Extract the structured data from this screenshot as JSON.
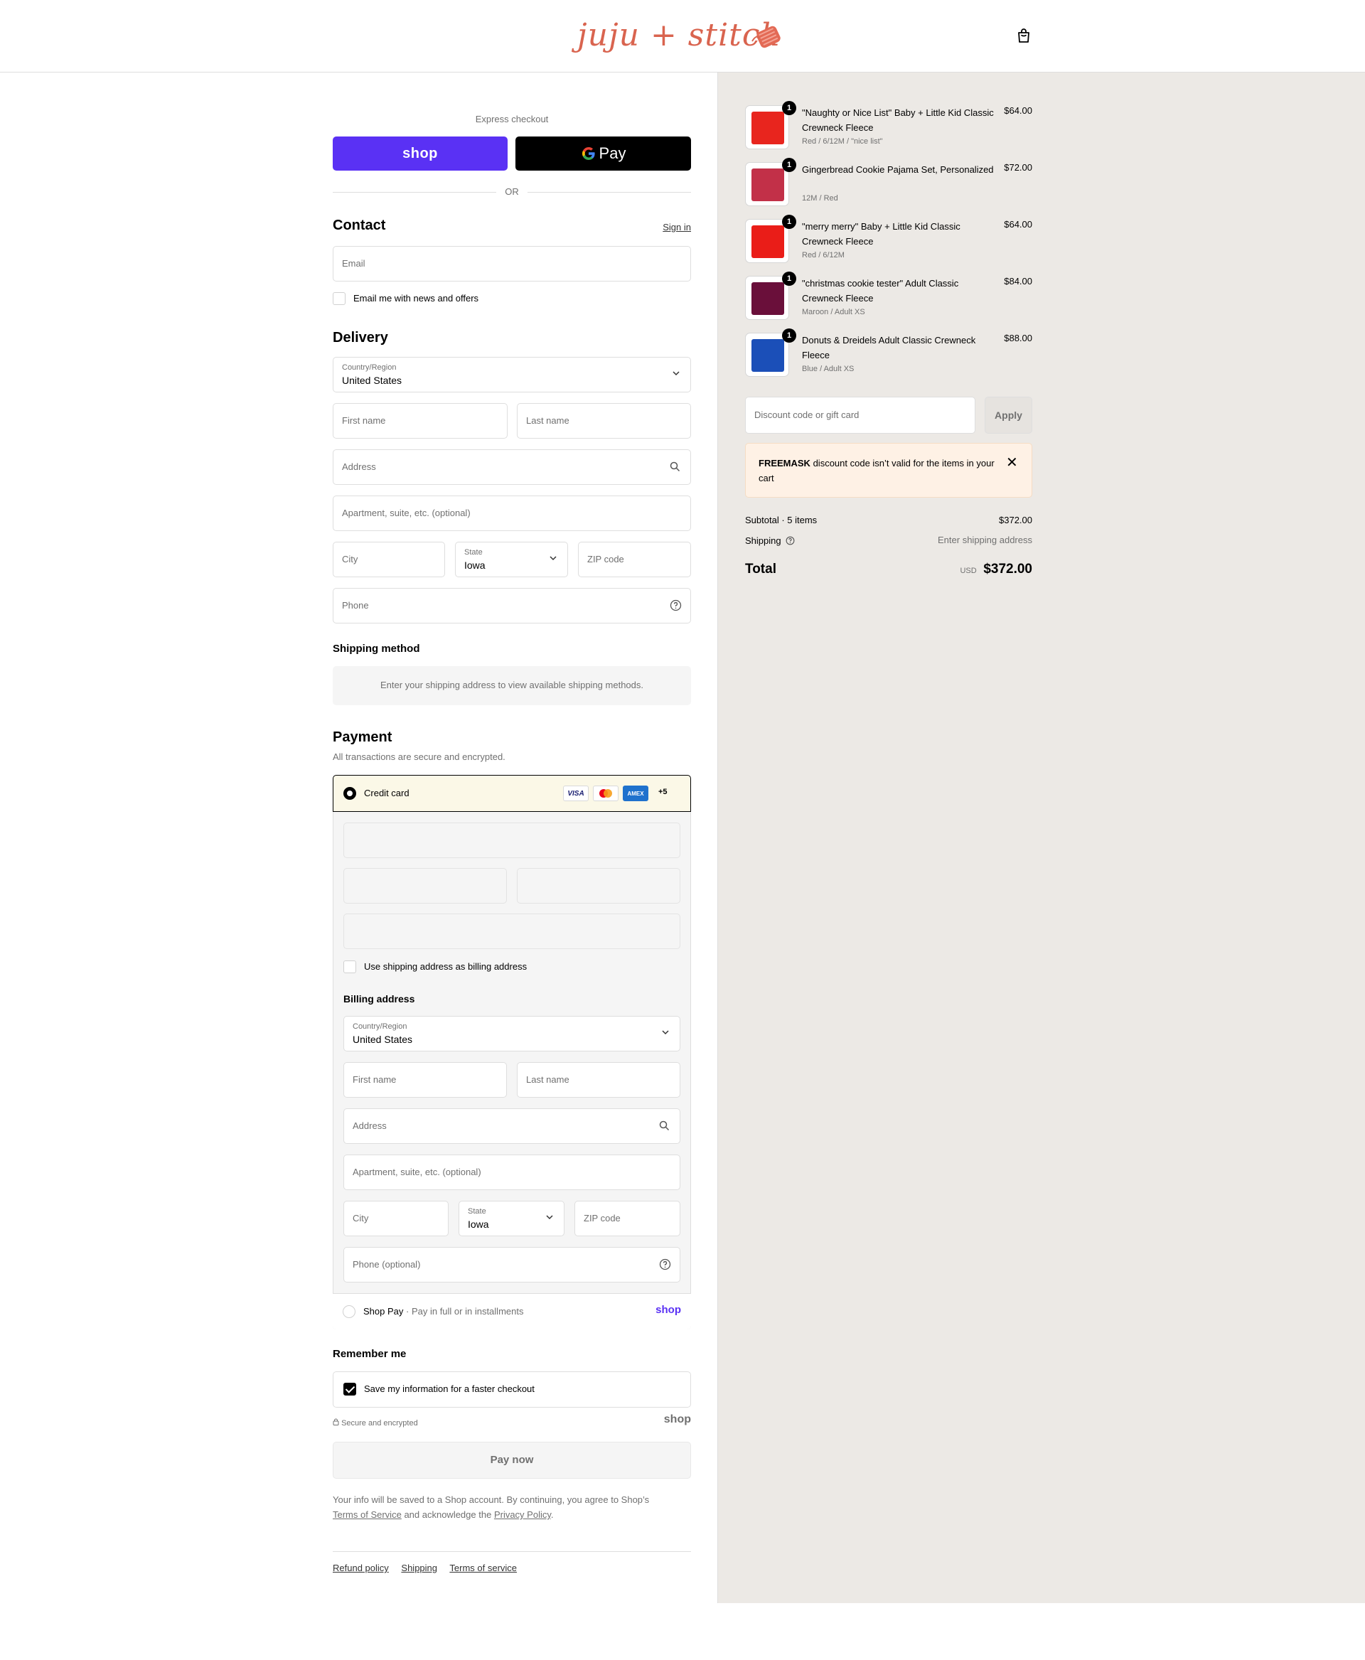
{
  "header": {
    "logo_text": "juju + stitch",
    "cart_icon": "shopping-bag-icon"
  },
  "express": {
    "label": "Express checkout",
    "shop_label": "shop",
    "gpay_label": "Pay",
    "or_label": "OR"
  },
  "contact": {
    "title": "Contact",
    "sign_in": "Sign in",
    "email_placeholder": "Email",
    "newsletter_label": "Email me with news and offers"
  },
  "delivery": {
    "title": "Delivery",
    "country_label": "Country/Region",
    "country_value": "United States",
    "first_name": "First name",
    "last_name": "Last name",
    "address": "Address",
    "apartment": "Apartment, suite, etc. (optional)",
    "city": "City",
    "state_label": "State",
    "state_value": "Iowa",
    "zip": "ZIP code",
    "phone": "Phone"
  },
  "shipping_method": {
    "title": "Shipping method",
    "info": "Enter your shipping address to view available shipping methods."
  },
  "payment": {
    "title": "Payment",
    "subtitle": "All transactions are secure and encrypted.",
    "credit_card": "Credit card",
    "card_logos": [
      "VISA",
      "AMEX"
    ],
    "more_cards": "+5",
    "use_shipping_billing": "Use shipping address as billing address",
    "billing_title": "Billing address",
    "billing": {
      "country_label": "Country/Region",
      "country_value": "United States",
      "first_name": "First name",
      "last_name": "Last name",
      "address": "Address",
      "apartment": "Apartment, suite, etc. (optional)",
      "city": "City",
      "state_label": "State",
      "state_value": "Iowa",
      "zip": "ZIP code",
      "phone": "Phone (optional)"
    },
    "shop_pay": "Shop Pay",
    "shop_pay_sub": "Pay in full or in installments",
    "shop_pay_logo": "shop"
  },
  "remember": {
    "title": "Remember me",
    "save_label": "Save my information for a faster checkout",
    "secure": "Secure and encrypted",
    "shop_logo": "shop"
  },
  "pay_now": "Pay now",
  "legal": {
    "text1": "Your info will be saved to a Shop account. By continuing, you agree to Shop’s",
    "terms": "Terms of Service",
    "text2": "and acknowledge the",
    "privacy": "Privacy Policy",
    "text3": "."
  },
  "footer": {
    "refund": "Refund policy",
    "shipping": "Shipping",
    "terms": "Terms of service"
  },
  "cart": {
    "items": [
      {
        "qty": "1",
        "name": "\"Naughty or Nice List\" Baby + Little Kid Classic Crewneck Fleece",
        "variant": "Red / 6/12M / \"nice list\"",
        "price": "$64.00",
        "color": "#e8251e"
      },
      {
        "qty": "1",
        "name": "Gingerbread Cookie Pajama Set, Personalized",
        "variant": "12M / Red",
        "price": "$72.00",
        "color": "#c23048"
      },
      {
        "qty": "1",
        "name": "\"merry merry\" Baby + Little Kid Classic Crewneck Fleece",
        "variant": "Red / 6/12M",
        "price": "$64.00",
        "color": "#ea1d18"
      },
      {
        "qty": "1",
        "name": "\"christmas cookie tester\" Adult Classic Crewneck Fleece",
        "variant": "Maroon / Adult XS",
        "price": "$84.00",
        "color": "#6a0f3a"
      },
      {
        "qty": "1",
        "name": "Donuts & Dreidels Adult Classic Crewneck Fleece",
        "variant": "Blue / Adult XS",
        "price": "$88.00",
        "color": "#1b4fb8"
      }
    ],
    "discount_placeholder": "Discount code or gift card",
    "apply": "Apply",
    "alert_code": "FREEMASK",
    "alert_text": "discount code isn’t valid for the items in your cart",
    "subtotal_label": "Subtotal · 5 items",
    "subtotal_value": "$372.00",
    "shipping_label": "Shipping",
    "shipping_value": "Enter shipping address",
    "total_label": "Total",
    "currency": "USD",
    "total_value": "$372.00"
  }
}
